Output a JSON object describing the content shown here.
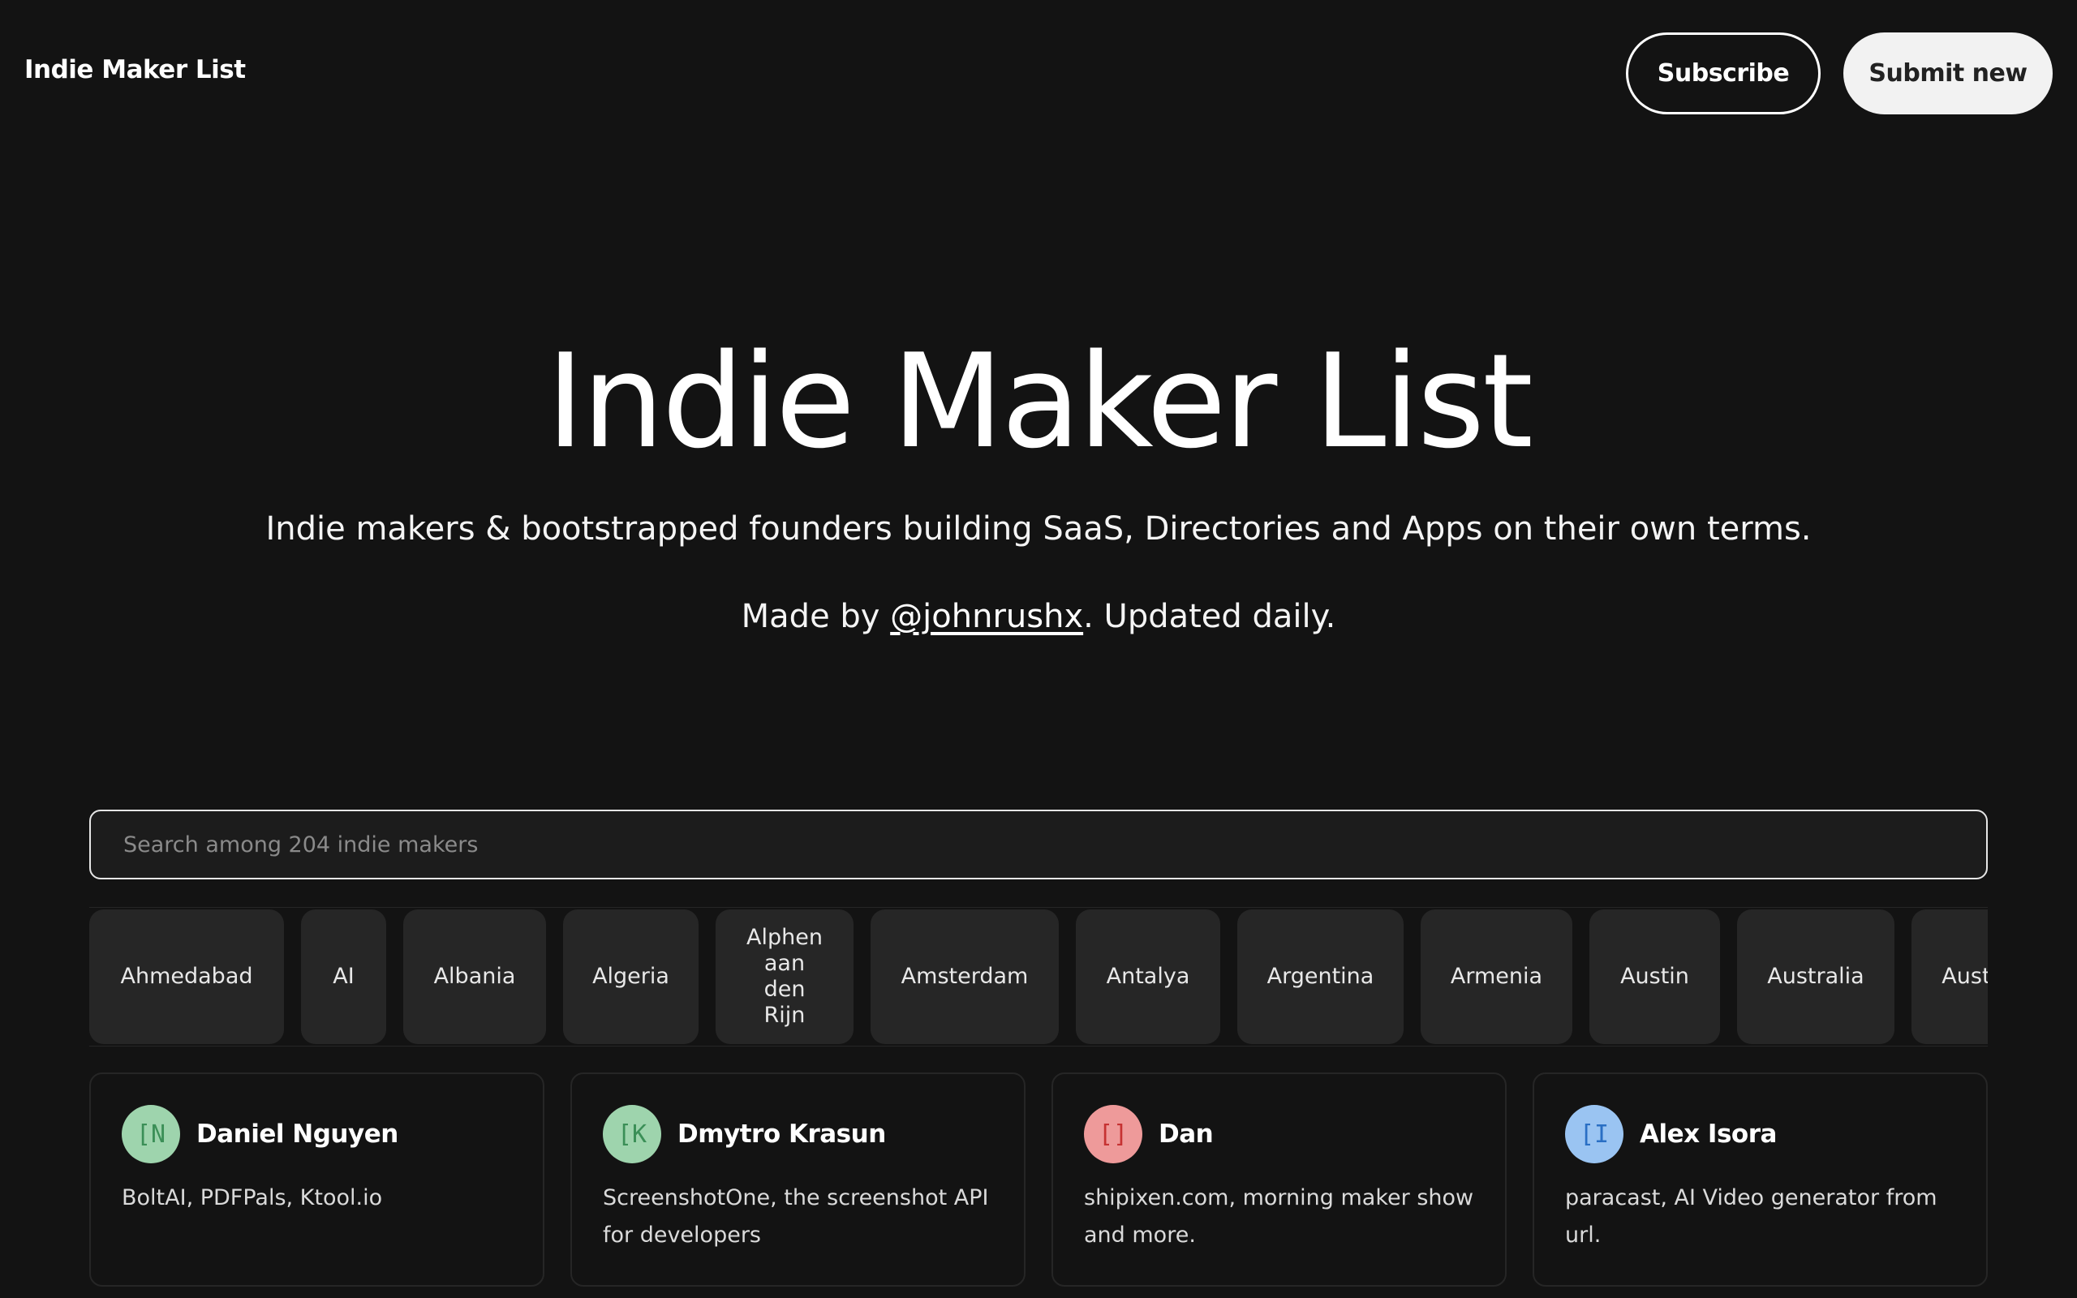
{
  "header": {
    "brand": "Indie Maker List",
    "subscribe_label": "Subscribe",
    "submit_label": "Submit new"
  },
  "hero": {
    "title": "Indie Maker List",
    "subtitle": "Indie makers & bootstrapped founders building SaaS, Directories and Apps on their own terms.",
    "made_prefix": "Made by ",
    "made_link": "@johnrushx",
    "made_suffix": ". Updated daily."
  },
  "search": {
    "placeholder": "Search among 204 indie makers",
    "value": ""
  },
  "tags": [
    {
      "label": "Ahmedabad"
    },
    {
      "label": "AI"
    },
    {
      "label": "Albania"
    },
    {
      "label": "Algeria"
    },
    {
      "label": "Alphen aan den Rijn"
    },
    {
      "label": "Amsterdam"
    },
    {
      "label": "Antalya"
    },
    {
      "label": "Argentina"
    },
    {
      "label": "Armenia"
    },
    {
      "label": "Austin"
    },
    {
      "label": "Australia"
    },
    {
      "label": "Austria"
    }
  ],
  "makers": [
    {
      "initials": "[N",
      "name": "Daniel Nguyen",
      "description": "BoltAI, PDFPals, Ktool.io",
      "avatar_bg": "#9ed4ad",
      "avatar_fg": "#3b8f57"
    },
    {
      "initials": "[K",
      "name": "Dmytro Krasun",
      "description": "ScreenshotOne, the screenshot API for developers",
      "avatar_bg": "#9ed4ad",
      "avatar_fg": "#3b8f57"
    },
    {
      "initials": "[]",
      "name": "Dan",
      "description": "shipixen.com, morning maker show and more.",
      "avatar_bg": "#ee9a9a",
      "avatar_fg": "#c63232"
    },
    {
      "initials": "[I",
      "name": "Alex Isora",
      "description": "paracast, AI Video generator from url.",
      "avatar_bg": "#9ac4f2",
      "avatar_fg": "#2a6fc4"
    }
  ]
}
